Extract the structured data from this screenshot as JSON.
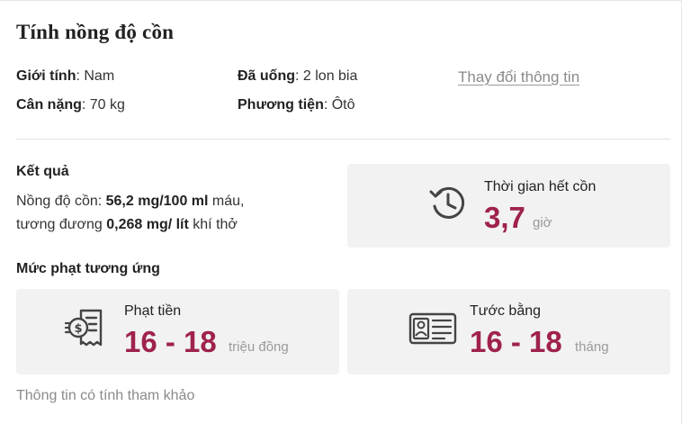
{
  "header": {
    "title": "Tính nồng độ cồn"
  },
  "profile": {
    "gender_label": "Giới tính",
    "gender_value": "Nam",
    "weight_label": "Cân nặng",
    "weight_value": "70 kg",
    "drank_label": "Đã uống",
    "drank_value": "2 lon bia",
    "vehicle_label": "Phương tiện",
    "vehicle_value": "Ôtô",
    "change_link": "Thay đổi thông tin"
  },
  "result": {
    "heading": "Kết quả",
    "line1_prefix": "Nồng độ cồn: ",
    "line1_value": "56,2 mg/100 ml",
    "line1_suffix": " máu,",
    "line2_prefix": "tương đương ",
    "line2_value": "0,268 mg/ lít",
    "line2_suffix": " khí thở"
  },
  "clear_time": {
    "label": "Thời gian hết cồn",
    "value": "3,7",
    "unit": "giờ",
    "icon": "history-clock-icon"
  },
  "penalty": {
    "heading": "Mức phạt tương ứng",
    "fine": {
      "label": "Phạt tiền",
      "value": "16 - 18",
      "unit": "triệu đồng",
      "icon": "money-receipt-icon"
    },
    "license": {
      "label": "Tước bằng",
      "value": "16 - 18",
      "unit": "tháng",
      "icon": "license-card-icon"
    }
  },
  "footnote": "Thông tin có tính tham khảo",
  "colors": {
    "accent": "#9f224e",
    "box_bg": "#f2f2f2",
    "muted_text": "#8a8a8a",
    "icon_stroke": "#444444"
  }
}
